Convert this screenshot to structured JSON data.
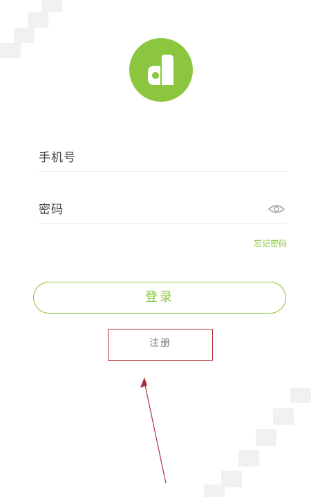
{
  "app": {
    "logo_icon": "app-a-logo-icon",
    "accent_color": "#8cc63f",
    "annotation_color": "#b2303b"
  },
  "form": {
    "phone_label": "手机号",
    "password_label": "密码",
    "show_password_icon": "eye-icon",
    "forgot_password_label": "忘记密码"
  },
  "actions": {
    "login_label": "登录",
    "register_label": "注册"
  }
}
